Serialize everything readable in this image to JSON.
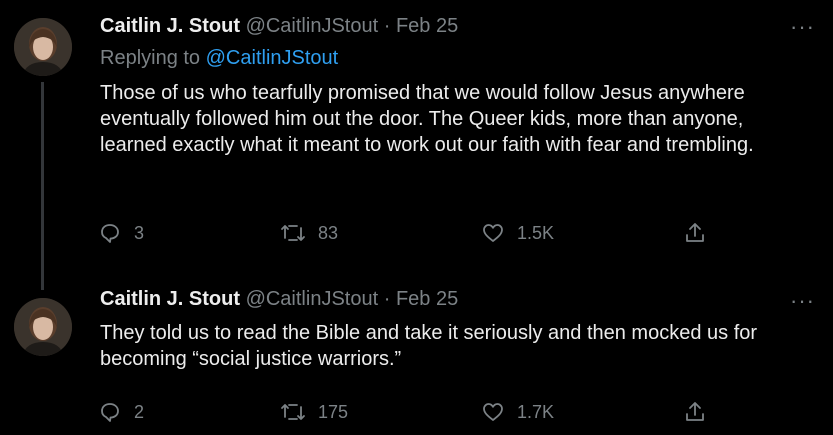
{
  "colors": {
    "background": "#000000",
    "text": "#ececec",
    "muted": "#7c8286",
    "link": "#2f9ff0"
  },
  "tweets": [
    {
      "display_name": "Caitlin J. Stout",
      "handle": "@CaitlinJStout",
      "separator": "·",
      "date": "Feb 25",
      "replying_prefix": "Replying to",
      "replying_handle": "@CaitlinJStout",
      "text": "Those of us who tearfully promised that we would follow Jesus anywhere eventually followed him out the door. The Queer kids, more than anyone, learned exactly what it meant to work out our faith with fear and trembling.",
      "more_label": "···",
      "replies": "3",
      "retweets": "83",
      "likes": "1.5K",
      "icons": [
        "reply-icon",
        "retweet-icon",
        "heart-icon",
        "share-icon"
      ]
    },
    {
      "display_name": "Caitlin J. Stout",
      "handle": "@CaitlinJStout",
      "separator": "·",
      "date": "Feb 25",
      "text": "They told us to read the Bible and take it seriously and then mocked us for becoming “social justice warriors.”",
      "more_label": "···",
      "replies": "2",
      "retweets": "175",
      "likes": "1.7K",
      "icons": [
        "reply-icon",
        "retweet-icon",
        "heart-icon",
        "share-icon"
      ]
    }
  ]
}
